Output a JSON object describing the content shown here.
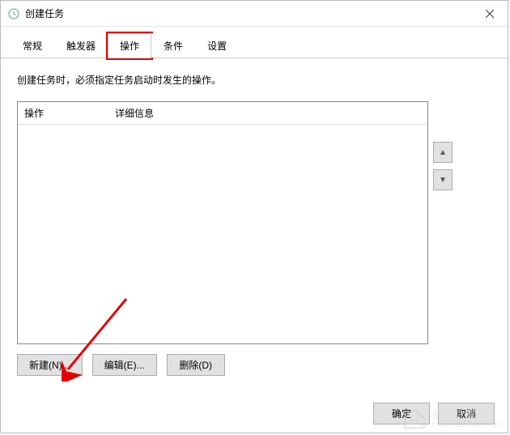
{
  "window": {
    "title": "创建任务"
  },
  "tabs": {
    "items": [
      {
        "label": "常规"
      },
      {
        "label": "触发器"
      },
      {
        "label": "操作"
      },
      {
        "label": "条件"
      },
      {
        "label": "设置"
      }
    ],
    "active_index": 2,
    "highlight_index": 2
  },
  "description": "创建任务时，必须指定任务启动时发生的操作。",
  "list": {
    "columns": {
      "action": "操作",
      "detail": "详细信息"
    }
  },
  "side_buttons": {
    "up": "▲",
    "down": "▼"
  },
  "buttons": {
    "new": "新建(N)...",
    "edit": "编辑(E)...",
    "delete": "删除(D)"
  },
  "footer": {
    "ok": "确定",
    "cancel": "取消"
  },
  "watermark": {
    "main": "系统之家",
    "sub": "XITONGZHIJIA.NET"
  },
  "annotation": {
    "type": "red-arrow",
    "target": "new-button"
  }
}
